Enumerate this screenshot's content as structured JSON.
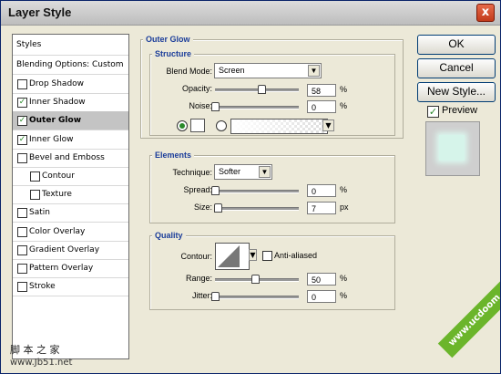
{
  "window": {
    "title": "Layer Style",
    "close_glyph": "x"
  },
  "styles_list": {
    "header": "Styles",
    "blending": "Blending Options: Custom",
    "items": [
      {
        "label": "Drop Shadow",
        "checked": false
      },
      {
        "label": "Inner Shadow",
        "checked": true
      },
      {
        "label": "Outer Glow",
        "checked": true,
        "selected": true
      },
      {
        "label": "Inner Glow",
        "checked": true
      },
      {
        "label": "Bevel and Emboss",
        "checked": false
      },
      {
        "label": "Contour",
        "checked": false,
        "indent": true
      },
      {
        "label": "Texture",
        "checked": false,
        "indent": true
      },
      {
        "label": "Satin",
        "checked": false
      },
      {
        "label": "Color Overlay",
        "checked": false
      },
      {
        "label": "Gradient Overlay",
        "checked": false
      },
      {
        "label": "Pattern Overlay",
        "checked": false
      },
      {
        "label": "Stroke",
        "checked": false
      }
    ]
  },
  "panel": {
    "title": "Outer Glow",
    "structure": {
      "label": "Structure",
      "blend_mode_label": "Blend Mode:",
      "blend_mode": "Screen",
      "opacity_label": "Opacity:",
      "opacity": "58",
      "opacity_unit": "%",
      "noise_label": "Noise:",
      "noise": "0",
      "noise_unit": "%"
    },
    "elements": {
      "label": "Elements",
      "technique_label": "Technique:",
      "technique": "Softer",
      "spread_label": "Spread:",
      "spread": "0",
      "spread_unit": "%",
      "size_label": "Size:",
      "size": "7",
      "size_unit": "px"
    },
    "quality": {
      "label": "Quality",
      "contour_label": "Contour:",
      "anti_aliased_label": "Anti-aliased",
      "range_label": "Range:",
      "range": "50",
      "range_unit": "%",
      "jitter_label": "Jitter:",
      "jitter": "0",
      "jitter_unit": "%"
    }
  },
  "buttons": {
    "ok": "OK",
    "cancel": "Cancel",
    "new_style": "New Style...",
    "preview_label": "Preview"
  },
  "watermarks": {
    "left_cn": "脚 本 之 家",
    "left_url": "www.Jb51.net",
    "banner": "www.ucdoom.com"
  },
  "colors": {
    "title_blue": "#1b3d9a",
    "check_green": "#2a8a2a",
    "glow": "#d6f4ea"
  },
  "sliders": {
    "opacity_fraction": 0.58,
    "noise_fraction": 0.0,
    "spread_fraction": 0.0,
    "size_fraction": 0.03,
    "range_fraction": 0.5,
    "jitter_fraction": 0.0
  }
}
